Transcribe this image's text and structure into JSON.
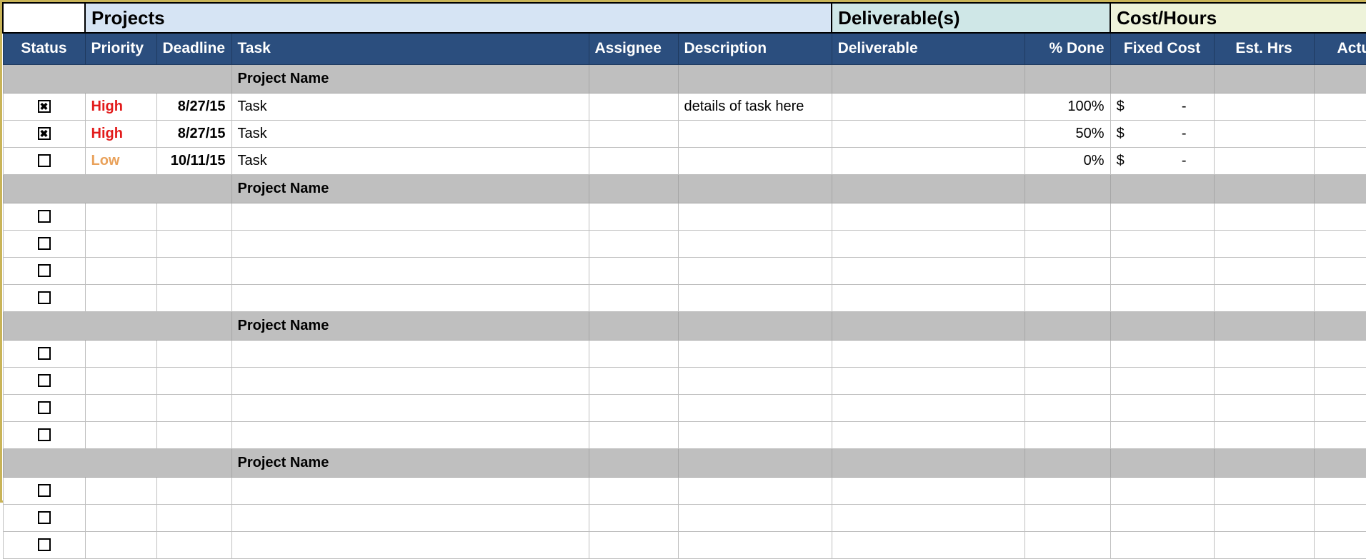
{
  "sections": {
    "projects": "Projects",
    "deliverables": "Deliverable(s)",
    "cost_hours": "Cost/Hours"
  },
  "headers": {
    "status": "Status",
    "priority": "Priority",
    "deadline": "Deadline",
    "task": "Task",
    "assignee": "Assignee",
    "description": "Description",
    "deliverable": "Deliverable",
    "pct_done": "% Done",
    "fixed_cost": "Fixed Cost",
    "est_hrs": "Est. Hrs",
    "actual_hrs": "Actual Hrs"
  },
  "project_label": "Project Name",
  "glyphs": {
    "checked": "✖",
    "unchecked": ""
  },
  "cost_display": {
    "symbol": "$",
    "dash": "-"
  },
  "groups": [
    {
      "rows": [
        {
          "status": "checked",
          "priority": "High",
          "priority_class": "pri-high",
          "deadline": "8/27/15",
          "task": "Task",
          "assignee": "",
          "description": "details of task here",
          "deliverable": "",
          "pct": "100%",
          "fixed": true,
          "est": "",
          "act": ""
        },
        {
          "status": "checked",
          "priority": "High",
          "priority_class": "pri-high",
          "deadline": "8/27/15",
          "task": "Task",
          "assignee": "",
          "description": "",
          "deliverable": "",
          "pct": "50%",
          "fixed": true,
          "est": "",
          "act": ""
        },
        {
          "status": "unchecked",
          "priority": "Low",
          "priority_class": "pri-low",
          "deadline": "10/11/15",
          "task": "Task",
          "assignee": "",
          "description": "",
          "deliverable": "",
          "pct": "0%",
          "fixed": true,
          "est": "",
          "act": ""
        }
      ]
    },
    {
      "rows": [
        {
          "status": "unchecked",
          "priority": "",
          "priority_class": "",
          "deadline": "",
          "task": "",
          "assignee": "",
          "description": "",
          "deliverable": "",
          "pct": "",
          "fixed": false,
          "est": "",
          "act": ""
        },
        {
          "status": "unchecked",
          "priority": "",
          "priority_class": "",
          "deadline": "",
          "task": "",
          "assignee": "",
          "description": "",
          "deliverable": "",
          "pct": "",
          "fixed": false,
          "est": "",
          "act": ""
        },
        {
          "status": "unchecked",
          "priority": "",
          "priority_class": "",
          "deadline": "",
          "task": "",
          "assignee": "",
          "description": "",
          "deliverable": "",
          "pct": "",
          "fixed": false,
          "est": "",
          "act": ""
        },
        {
          "status": "unchecked",
          "priority": "",
          "priority_class": "",
          "deadline": "",
          "task": "",
          "assignee": "",
          "description": "",
          "deliverable": "",
          "pct": "",
          "fixed": false,
          "est": "",
          "act": ""
        }
      ]
    },
    {
      "rows": [
        {
          "status": "unchecked",
          "priority": "",
          "priority_class": "",
          "deadline": "",
          "task": "",
          "assignee": "",
          "description": "",
          "deliverable": "",
          "pct": "",
          "fixed": false,
          "est": "",
          "act": ""
        },
        {
          "status": "unchecked",
          "priority": "",
          "priority_class": "",
          "deadline": "",
          "task": "",
          "assignee": "",
          "description": "",
          "deliverable": "",
          "pct": "",
          "fixed": false,
          "est": "",
          "act": ""
        },
        {
          "status": "unchecked",
          "priority": "",
          "priority_class": "",
          "deadline": "",
          "task": "",
          "assignee": "",
          "description": "",
          "deliverable": "",
          "pct": "",
          "fixed": false,
          "est": "",
          "act": ""
        },
        {
          "status": "unchecked",
          "priority": "",
          "priority_class": "",
          "deadline": "",
          "task": "",
          "assignee": "",
          "description": "",
          "deliverable": "",
          "pct": "",
          "fixed": false,
          "est": "",
          "act": ""
        }
      ]
    },
    {
      "rows": [
        {
          "status": "unchecked",
          "priority": "",
          "priority_class": "",
          "deadline": "",
          "task": "",
          "assignee": "",
          "description": "",
          "deliverable": "",
          "pct": "",
          "fixed": false,
          "est": "",
          "act": ""
        },
        {
          "status": "unchecked",
          "priority": "",
          "priority_class": "",
          "deadline": "",
          "task": "",
          "assignee": "",
          "description": "",
          "deliverable": "",
          "pct": "",
          "fixed": false,
          "est": "",
          "act": ""
        },
        {
          "status": "unchecked",
          "priority": "",
          "priority_class": "",
          "deadline": "",
          "task": "",
          "assignee": "",
          "description": "",
          "deliverable": "",
          "pct": "",
          "fixed": false,
          "est": "",
          "act": ""
        }
      ]
    }
  ]
}
